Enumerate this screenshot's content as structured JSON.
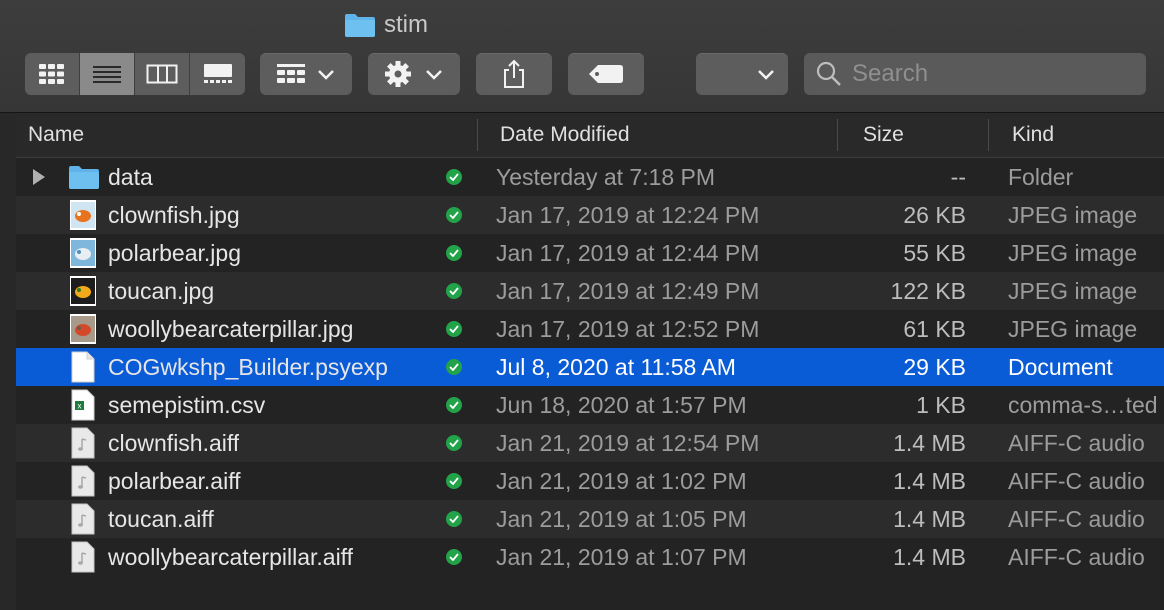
{
  "window": {
    "title": "stim"
  },
  "toolbar": {
    "view_modes": [
      "icon",
      "list",
      "column",
      "gallery"
    ],
    "active_view": "list",
    "search_placeholder": "Search"
  },
  "columns": {
    "name": "Name",
    "date": "Date Modified",
    "size": "Size",
    "kind": "Kind"
  },
  "files": [
    {
      "name": "data",
      "date": "Yesterday at 7:18 PM",
      "size": "--",
      "kind": "Folder",
      "icon": "folder-icon",
      "synced": true,
      "selected": false
    },
    {
      "name": "clownfish.jpg",
      "date": "Jan 17, 2019 at 12:24 PM",
      "size": "26 KB",
      "kind": "JPEG image",
      "icon": "jpeg-thumbnail-icon",
      "synced": true,
      "selected": false
    },
    {
      "name": "polarbear.jpg",
      "date": "Jan 17, 2019 at 12:44 PM",
      "size": "55 KB",
      "kind": "JPEG image",
      "icon": "jpeg-thumbnail-icon",
      "synced": true,
      "selected": false
    },
    {
      "name": "toucan.jpg",
      "date": "Jan 17, 2019 at 12:49 PM",
      "size": "122 KB",
      "kind": "JPEG image",
      "icon": "jpeg-thumbnail-icon",
      "synced": true,
      "selected": false
    },
    {
      "name": "woollybearcaterpillar.jpg",
      "date": "Jan 17, 2019 at 12:52 PM",
      "size": "61 KB",
      "kind": "JPEG image",
      "icon": "jpeg-thumbnail-icon",
      "synced": true,
      "selected": false
    },
    {
      "name": "COGwkshp_Builder.psyexp",
      "date": "Jul 8, 2020 at 11:58 AM",
      "size": "29 KB",
      "kind": "Document",
      "icon": "document-icon",
      "synced": true,
      "selected": true
    },
    {
      "name": "semepistim.csv",
      "date": "Jun 18, 2020 at 1:57 PM",
      "size": "1 KB",
      "kind": "comma-s…ted",
      "icon": "csv-icon",
      "synced": true,
      "selected": false
    },
    {
      "name": "clownfish.aiff",
      "date": "Jan 21, 2019 at 12:54 PM",
      "size": "1.4 MB",
      "kind": "AIFF-C audio",
      "icon": "audio-file-icon",
      "synced": true,
      "selected": false
    },
    {
      "name": "polarbear.aiff",
      "date": "Jan 21, 2019 at 1:02 PM",
      "size": "1.4 MB",
      "kind": "AIFF-C audio",
      "icon": "audio-file-icon",
      "synced": true,
      "selected": false
    },
    {
      "name": "toucan.aiff",
      "date": "Jan 21, 2019 at 1:05 PM",
      "size": "1.4 MB",
      "kind": "AIFF-C audio",
      "icon": "audio-file-icon",
      "synced": true,
      "selected": false
    },
    {
      "name": "woollybearcaterpillar.aiff",
      "date": "Jan 21, 2019 at 1:07 PM",
      "size": "1.4 MB",
      "kind": "AIFF-C audio",
      "icon": "audio-file-icon",
      "synced": true,
      "selected": false
    }
  ],
  "colors": {
    "selection": "#0a5bd6",
    "sync_check": "#22a34a",
    "folder": "#5fb3e8"
  }
}
